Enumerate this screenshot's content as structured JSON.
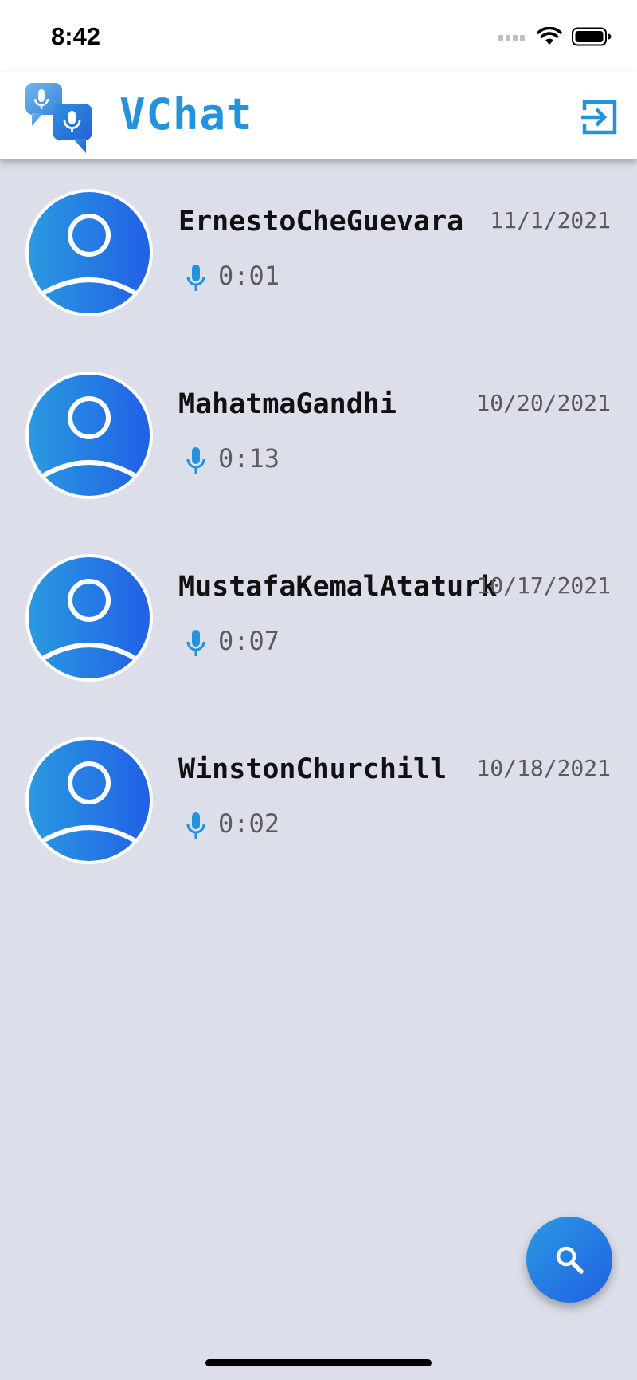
{
  "status_bar": {
    "time": "8:42"
  },
  "app_bar": {
    "title": "VChat",
    "logo_icon": "voice-chat-bubbles-icon",
    "logout_icon": "logout-icon"
  },
  "colors": {
    "accent": "#2493dc",
    "avatar_gradient_start": "#2a9ae0",
    "avatar_gradient_end": "#2160e6",
    "background": "#dcdee9"
  },
  "chats": [
    {
      "name": "ErnestoCheGuevara",
      "date": "11/1/2021",
      "duration": "0:01"
    },
    {
      "name": "MahatmaGandhi",
      "date": "10/20/2021",
      "duration": "0:13"
    },
    {
      "name": "MustafaKemalAtaturk",
      "date": "10/17/2021",
      "duration": "0:07"
    },
    {
      "name": "WinstonChurchill",
      "date": "10/18/2021",
      "duration": "0:02"
    }
  ],
  "fab": {
    "icon": "search-icon"
  }
}
